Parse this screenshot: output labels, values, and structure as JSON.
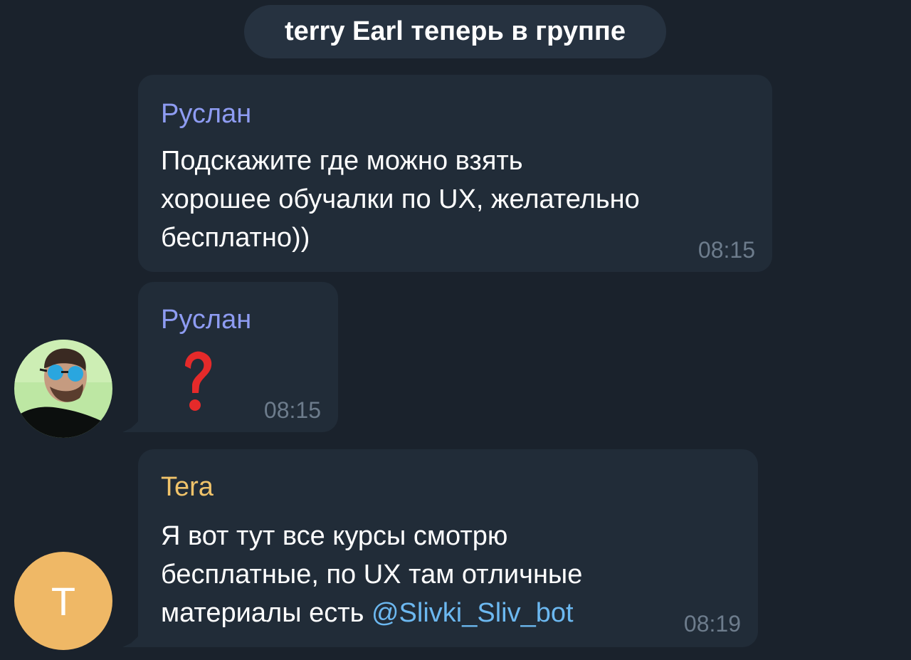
{
  "service_message": "terry Earl теперь в группе",
  "messages": [
    {
      "sender": "Руслан",
      "sender_color": "#8e9cf2",
      "lines": [
        "Подскажите где можно взять",
        "хорошее обучалки по UX, желательно",
        "бесплатно))"
      ],
      "time": "08:15"
    },
    {
      "sender": "Руслан",
      "sender_color": "#8e9cf2",
      "emoji": "question-mark-emoji",
      "time": "08:15"
    },
    {
      "sender": "Tera",
      "sender_color": "#f0c36a",
      "lines": [
        "Я вот тут все курсы смотрю",
        "бесплатные, по UX там отличные",
        "материалы есть "
      ],
      "mention": "@Slivki_Sliv_bot",
      "time": "08:19"
    }
  ],
  "avatars": {
    "ruslan": {
      "icon": "user-photo-avatar"
    },
    "tera": {
      "letter": "T",
      "color": "#efb866"
    }
  }
}
